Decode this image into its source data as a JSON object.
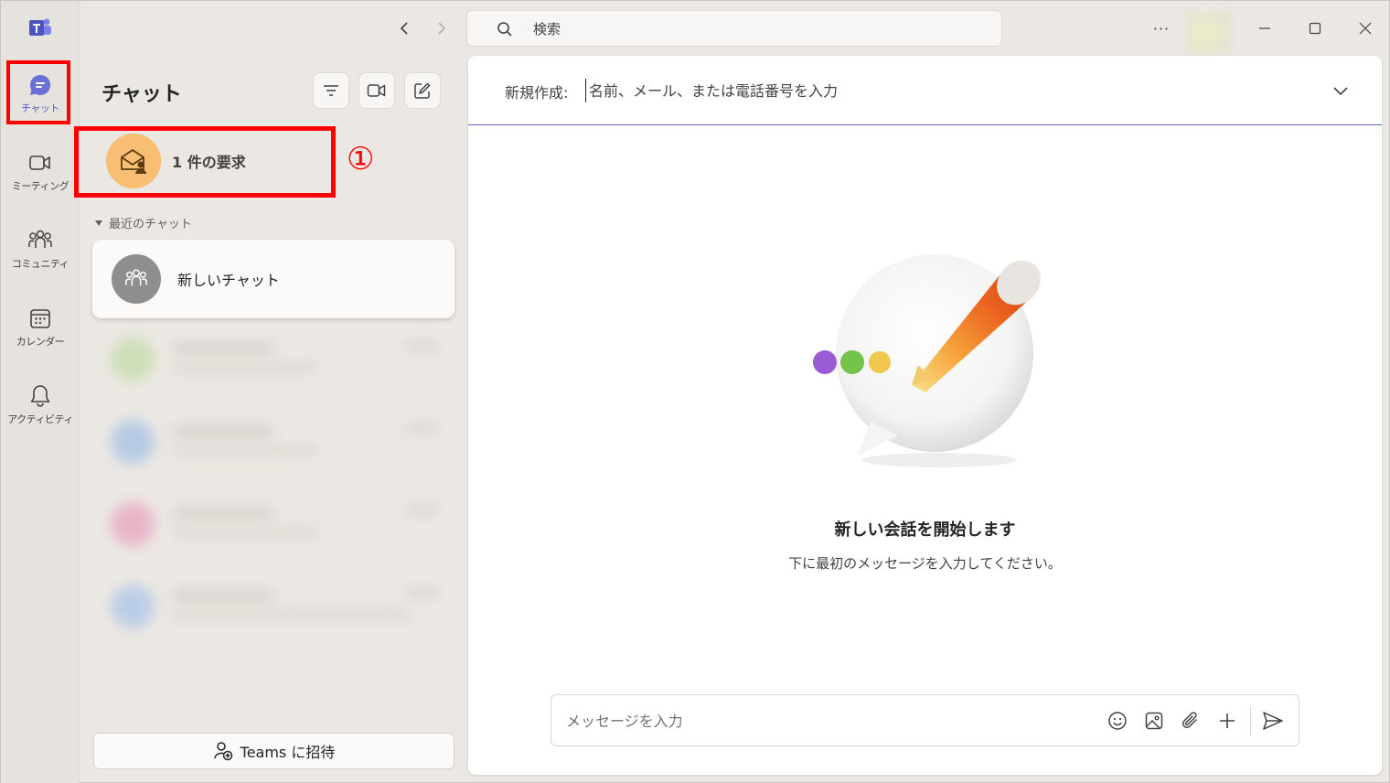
{
  "rail": {
    "items": [
      {
        "label": "チャット",
        "icon": "chat-icon",
        "active": true
      },
      {
        "label": "ミーティング",
        "icon": "video-camera-icon"
      },
      {
        "label": "コミュニティ",
        "icon": "community-icon"
      },
      {
        "label": "カレンダー",
        "icon": "calendar-icon"
      },
      {
        "label": "アクティビティ",
        "icon": "bell-icon"
      }
    ]
  },
  "titlebar": {
    "search_placeholder": "検索",
    "more_label": "···"
  },
  "chat_pane": {
    "title": "チャット",
    "request_label": "1 件の要求",
    "annotation_number": "①",
    "recent_section": "最近のチャット",
    "new_chat_label": "新しいチャット",
    "invite_label": "Teams に招待"
  },
  "main": {
    "to_label": "新規作成:",
    "to_placeholder": "名前、メール、または電話番号を入力",
    "empty_title": "新しい会話を開始します",
    "empty_subtitle": "下に最初のメッセージを入力してください。",
    "composer_placeholder": "メッセージを入力"
  },
  "colors": {
    "accent": "#5b5fc7",
    "highlight": "#ff0000",
    "request_avatar": "#f7be74"
  }
}
